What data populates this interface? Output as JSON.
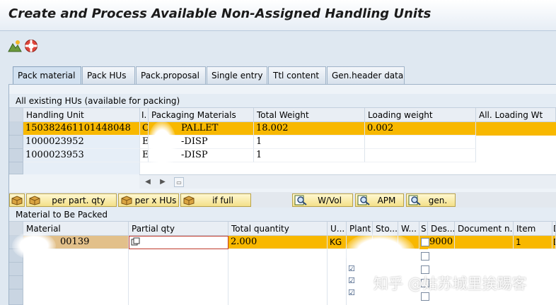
{
  "window": {
    "title": "Create and Process Available Non-Assigned Handling Units"
  },
  "toolbar": {
    "icons": [
      "mountain-icon",
      "lifebuoy-icon"
    ]
  },
  "tabs": [
    {
      "label": "Pack material",
      "active": true
    },
    {
      "label": "Pack HUs"
    },
    {
      "label": "Pack.proposal"
    },
    {
      "label": "Single entry"
    },
    {
      "label": "Ttl content"
    },
    {
      "label": "Gen.header data"
    }
  ],
  "hu_section": {
    "title": "All existing HUs (available for packing)",
    "columns": [
      "Handling Unit",
      "I.",
      "Packaging Materials",
      "Total Weight",
      "Loading weight",
      "All. Loading Wt"
    ],
    "rows": [
      {
        "hu": "150382461101448048",
        "i": "C",
        "pkg": "PALLET",
        "total_weight": "18.002",
        "loading_weight": "0.002",
        "highlighted": true
      },
      {
        "hu": "1000023952",
        "i": "E",
        "pkg": "-DISP",
        "total_weight": "1",
        "loading_weight": ""
      },
      {
        "hu": "1000023953",
        "i": "E",
        "pkg": "-DISP",
        "total_weight": "1",
        "loading_weight": ""
      }
    ]
  },
  "pack_buttons": [
    {
      "label": "per part. qty"
    },
    {
      "label": "per x HUs"
    },
    {
      "label": "if full"
    },
    {
      "label": "W/Vol"
    },
    {
      "label": "APM"
    },
    {
      "label": "gen."
    }
  ],
  "material_section": {
    "title": "Material to Be Packed",
    "columns": [
      "Material",
      "Partial qty",
      "Total quantity",
      "U...",
      "Plant",
      "Sto...",
      "W...",
      "S",
      "Des...",
      "Document n...",
      "Item",
      "D"
    ],
    "rows": [
      {
        "material": "00139",
        "partial_qty": "",
        "total_quantity": "2.000",
        "unit": "KG",
        "plant": "",
        "dest": "9000",
        "item": "1",
        "d": "D"
      }
    ]
  },
  "watermark": "知乎 @姑苏城里挨踢客",
  "colors": {
    "highlight": "#f8b800",
    "background": "#dfe8f1",
    "title_text": "#1b1b1b"
  }
}
